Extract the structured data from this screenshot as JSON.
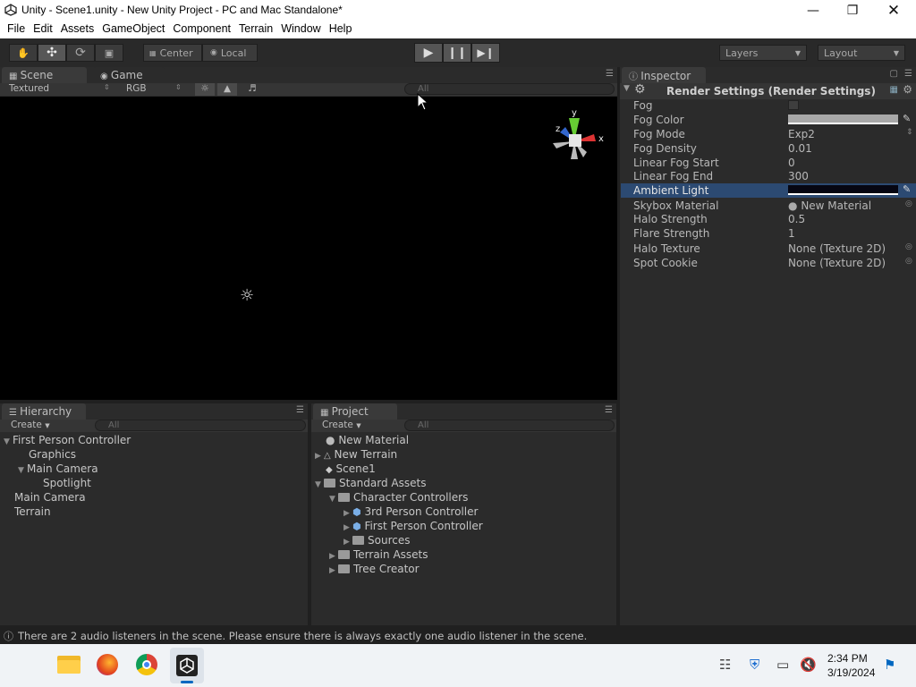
{
  "window": {
    "title": "Unity - Scene1.unity - New Unity Project - PC and Mac Standalone*"
  },
  "menu": [
    "File",
    "Edit",
    "Assets",
    "GameObject",
    "Component",
    "Terrain",
    "Window",
    "Help"
  ],
  "toolbar": {
    "pivot_label": "Center",
    "space_label": "Local",
    "layers_label": "Layers",
    "layout_label": "Layout"
  },
  "scene": {
    "tab_scene": "Scene",
    "tab_game": "Game",
    "draw_mode": "Textured",
    "render_mode": "RGB",
    "search_placeholder": "All",
    "gizmo": {
      "y": "y",
      "x": "x",
      "z": "z"
    }
  },
  "hierarchy": {
    "tab": "Hierarchy",
    "create": "Create",
    "search_placeholder": "All",
    "items": [
      "First Person Controller",
      "Graphics",
      "Main Camera",
      "Spotlight",
      "Main Camera",
      "Terrain"
    ]
  },
  "project": {
    "tab": "Project",
    "create": "Create",
    "search_placeholder": "All",
    "items": [
      "New Material",
      "New Terrain",
      "Scene1",
      "Standard Assets",
      "Character Controllers",
      "3rd Person Controller",
      "First Person Controller",
      "Sources",
      "Terrain Assets",
      "Tree Creator"
    ]
  },
  "inspector": {
    "tab": "Inspector",
    "header": "Render Settings (Render Settings)",
    "rows": [
      {
        "label": "Fog",
        "value": ""
      },
      {
        "label": "Fog Color",
        "value": ""
      },
      {
        "label": "Fog Mode",
        "value": "Exp2"
      },
      {
        "label": "Fog Density",
        "value": "0.01"
      },
      {
        "label": "Linear Fog Start",
        "value": "0"
      },
      {
        "label": "Linear Fog End",
        "value": "300"
      },
      {
        "label": "Ambient Light",
        "value": ""
      },
      {
        "label": "Skybox Material",
        "value": "New Material"
      },
      {
        "label": "Halo Strength",
        "value": "0.5"
      },
      {
        "label": "Flare Strength",
        "value": "1"
      },
      {
        "label": "Halo Texture",
        "value": "None (Texture 2D)"
      },
      {
        "label": "Spot Cookie",
        "value": "None (Texture 2D)"
      }
    ]
  },
  "status": {
    "message": "There are 2 audio listeners in the scene. Please ensure there is always exactly one audio listener in the scene."
  },
  "taskbar": {
    "time": "2:34 PM",
    "date": "3/19/2024"
  },
  "colors": {
    "selection": "#2c4a72",
    "accent": "#0067c0",
    "fog_color": "#a8a8a8"
  }
}
